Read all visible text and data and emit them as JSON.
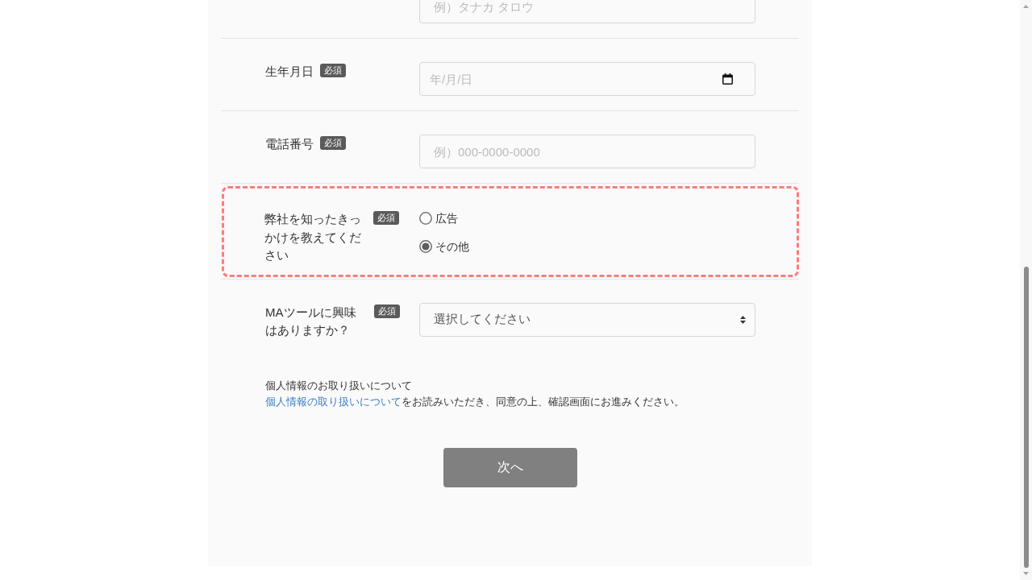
{
  "form": {
    "fields": [
      {
        "kind": "text",
        "highlighted": false,
        "placeholder": "例）タナカ タロウ"
      },
      {
        "kind": "date",
        "highlighted": false,
        "label": "生年月日",
        "badge": "必須",
        "placeholder": "年/月/日"
      },
      {
        "kind": "text",
        "highlighted": false,
        "label": "電話番号",
        "badge": "必須",
        "placeholder": "例）000-0000-0000"
      },
      {
        "kind": "radio",
        "highlighted": true,
        "label": "弊社を知ったきっかけを教えてください",
        "badge": "必須",
        "options": [
          {
            "label": "広告",
            "selected": false
          },
          {
            "label": "その他",
            "selected": true
          }
        ]
      },
      {
        "kind": "select",
        "highlighted": false,
        "label": "MAツールに興味はありますか？",
        "badge": "必須",
        "value": "選択してください"
      }
    ],
    "privacy": {
      "heading": "個人情報のお取り扱いについて",
      "link": "個人情報の取り扱いについて",
      "text": "をお読みいただき、同意の上、確認画面にお進みください。"
    },
    "submit_button": "次へ"
  }
}
